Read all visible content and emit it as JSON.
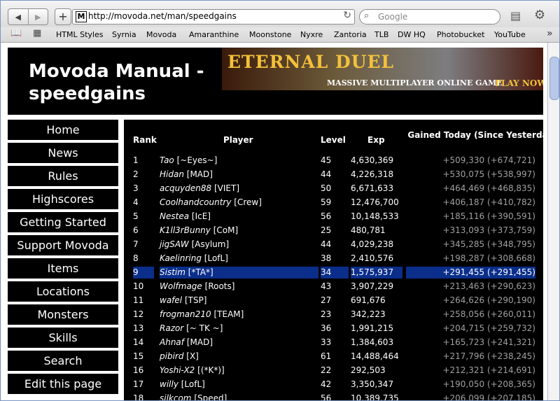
{
  "browser": {
    "back_symbol": "◀",
    "forward_symbol": "▶",
    "newtab_symbol": "+",
    "favicon_letter": "M",
    "url": "http://movoda.net/man/speedgains",
    "search_placeholder": "Google"
  },
  "bookmarks": [
    "HTML Styles",
    "Syrnia",
    "Movoda",
    "Amaranthine",
    "Moonstone",
    "Nyxre",
    "Zantoria",
    "TLB",
    "DW HQ",
    "Photobucket",
    "YouTube"
  ],
  "header": {
    "title": "Movoda Manual - speedgains",
    "banner_title": "ETERNAL DUEL",
    "banner_subtitle": "MASSIVE MULTIPLAYER ONLINE GAME",
    "banner_cta": "PLAY NOW"
  },
  "sidebar": [
    {
      "label": "Home"
    },
    {
      "label": "News"
    },
    {
      "label": "Rules"
    },
    {
      "label": "Highscores"
    },
    {
      "label": "Getting Started"
    },
    {
      "label": "Support Movoda"
    },
    {
      "label": "Items"
    },
    {
      "label": "Locations"
    },
    {
      "label": "Monsters"
    },
    {
      "label": "Skills"
    },
    {
      "label": "Search"
    },
    {
      "label": "Edit this page"
    }
  ],
  "table": {
    "columns": {
      "rank": "Rank",
      "player": "Player",
      "level": "Level",
      "exp": "Exp",
      "gained": "Gained Today (Since Yesterday)"
    },
    "highlight_color": "#0a2e8a",
    "rows": [
      {
        "rank": "1",
        "name": "Tao",
        "guild": "[~Eyes~]",
        "level": "45",
        "exp": "4,630,369",
        "gained": "+509,330 (+674,721)"
      },
      {
        "rank": "2",
        "name": "Hidan",
        "guild": "[MAD]",
        "level": "44",
        "exp": "4,226,318",
        "gained": "+530,075 (+538,997)"
      },
      {
        "rank": "3",
        "name": "acquyden88",
        "guild": "[VIET]",
        "level": "50",
        "exp": "6,671,633",
        "gained": "+464,469 (+468,835)"
      },
      {
        "rank": "4",
        "name": "Coolhandcountry",
        "guild": "[Crew]",
        "level": "59",
        "exp": "12,476,700",
        "gained": "+406,187 (+410,782)"
      },
      {
        "rank": "5",
        "name": "Nestea",
        "guild": "[IcE]",
        "level": "56",
        "exp": "10,148,533",
        "gained": "+185,116 (+390,591)"
      },
      {
        "rank": "6",
        "name": "K1ll3rBunny",
        "guild": "[CoM]",
        "level": "25",
        "exp": "480,781",
        "gained": "+313,093 (+373,759)"
      },
      {
        "rank": "7",
        "name": "jigSAW",
        "guild": "[Asylum]",
        "level": "44",
        "exp": "4,029,238",
        "gained": "+345,285 (+348,795)"
      },
      {
        "rank": "8",
        "name": "Kaelinring",
        "guild": "[LofL]",
        "level": "38",
        "exp": "2,410,576",
        "gained": "+198,287 (+308,668)"
      },
      {
        "rank": "9",
        "name": "Sistim",
        "guild": "[*TA*]",
        "level": "34",
        "exp": "1,575,937",
        "gained": "+291,455 (+291,455)",
        "highlight": true
      },
      {
        "rank": "10",
        "name": "Wolfmage",
        "guild": "[Roots]",
        "level": "43",
        "exp": "3,907,229",
        "gained": "+213,463 (+290,623)"
      },
      {
        "rank": "11",
        "name": "wafel",
        "guild": "[TSP]",
        "level": "27",
        "exp": "691,676",
        "gained": "+264,626 (+290,190)"
      },
      {
        "rank": "12",
        "name": "frogman210",
        "guild": "[TEAM]",
        "level": "23",
        "exp": "342,223",
        "gained": "+258,056 (+260,011)"
      },
      {
        "rank": "13",
        "name": "Razor",
        "guild": "[~ TK ~]",
        "level": "36",
        "exp": "1,991,215",
        "gained": "+204,715 (+259,732)"
      },
      {
        "rank": "14",
        "name": "Ahnaf",
        "guild": "[MAD]",
        "level": "33",
        "exp": "1,384,603",
        "gained": "+165,723 (+241,321)"
      },
      {
        "rank": "15",
        "name": "pibird",
        "guild": "[X]",
        "level": "61",
        "exp": "14,488,464",
        "gained": "+217,796 (+238,245)"
      },
      {
        "rank": "16",
        "name": "Yoshi-X2",
        "guild": "[(*K*)]",
        "level": "22",
        "exp": "292,503",
        "gained": "+212,321 (+214,691)"
      },
      {
        "rank": "17",
        "name": "willy",
        "guild": "[LofL]",
        "level": "42",
        "exp": "3,350,347",
        "gained": "+190,050 (+208,365)"
      },
      {
        "rank": "18",
        "name": "silkcom",
        "guild": "[Speed]",
        "level": "56",
        "exp": "10,389,735",
        "gained": "+206,099 (+207,185)"
      }
    ]
  }
}
